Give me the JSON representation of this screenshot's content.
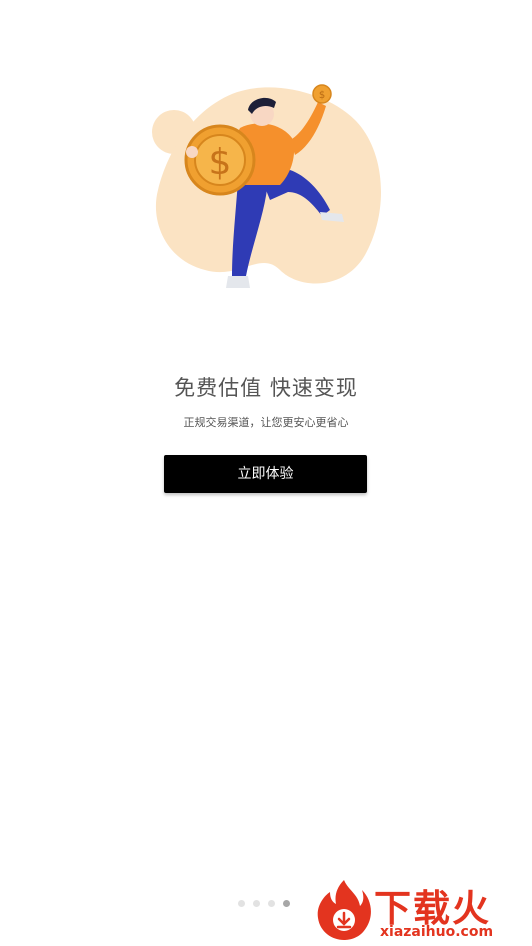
{
  "onboarding": {
    "title": "免费估值 快速变现",
    "subtitle": "正规交易渠道，让您更安心更省心",
    "cta_label": "立即体验",
    "page_count": 4,
    "active_page": 4,
    "illustration": "person-holding-dollar-coin-illustration"
  },
  "watermark": {
    "text": "下载火",
    "url": "xiazaihuo.com",
    "brand_color": "#e3341f"
  },
  "colors": {
    "cta_background": "#000000",
    "blob": "#fbe3c3",
    "coin": "#f0a030",
    "shirt": "#f5902c",
    "pants": "#2f3bb5"
  }
}
